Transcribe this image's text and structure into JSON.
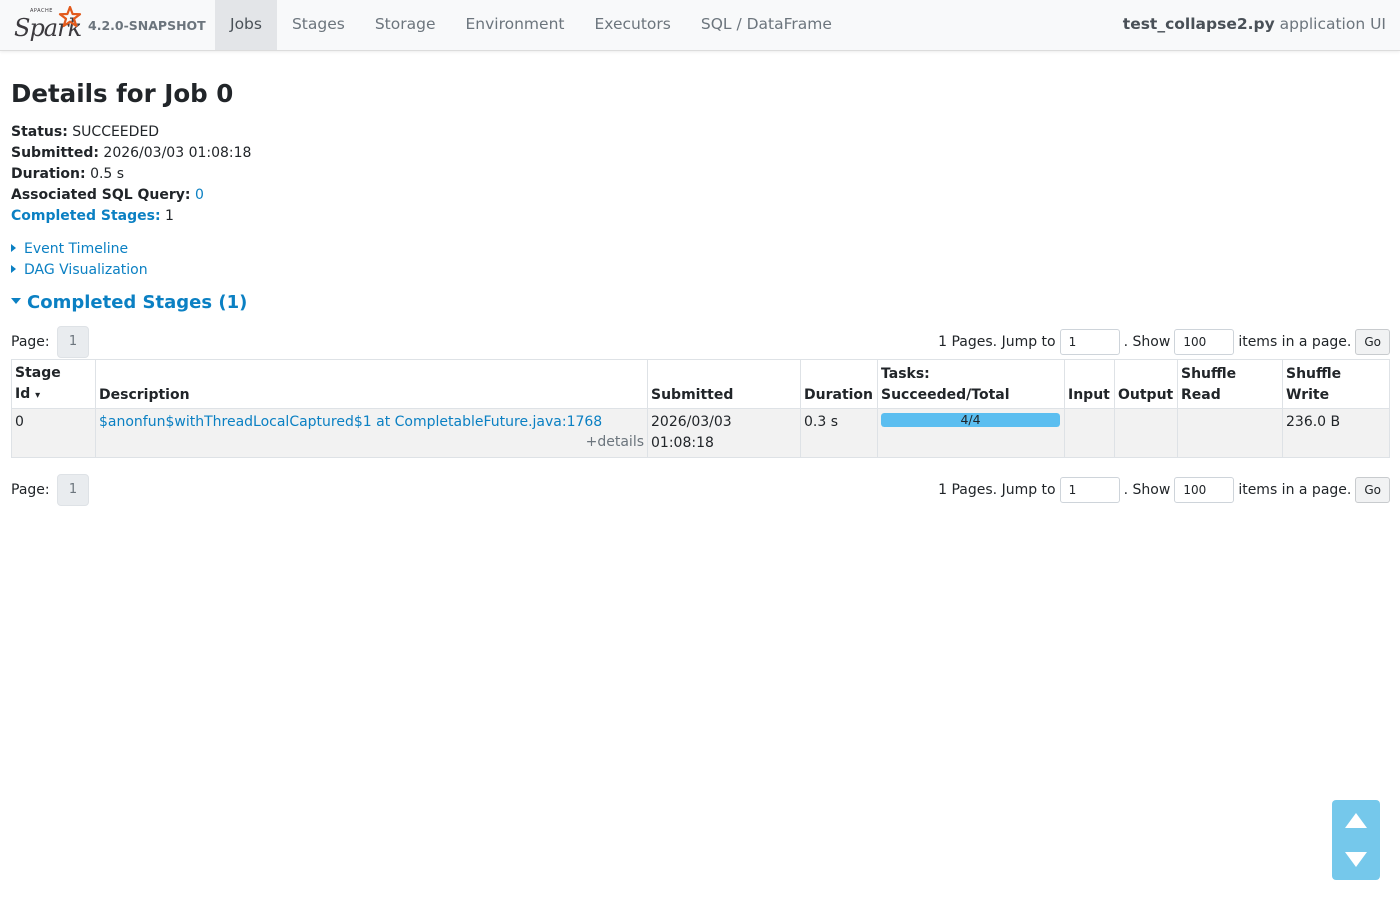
{
  "navbar": {
    "brand_word": "Spark",
    "brand_apache": "APACHE",
    "version": "4.2.0-SNAPSHOT",
    "tabs": [
      {
        "label": "Jobs"
      },
      {
        "label": "Stages"
      },
      {
        "label": "Storage"
      },
      {
        "label": "Environment"
      },
      {
        "label": "Executors"
      },
      {
        "label": "SQL / DataFrame"
      }
    ],
    "active_tab": "Jobs",
    "app_name": "test_collapse2.py",
    "app_suffix": "application UI"
  },
  "page": {
    "title": "Details for Job 0"
  },
  "summary": {
    "status_label": "Status:",
    "status_value": "SUCCEEDED",
    "submitted_label": "Submitted:",
    "submitted_value": "2026/03/03 01:08:18",
    "duration_label": "Duration:",
    "duration_value": "0.5 s",
    "sql_label": "Associated SQL Query:",
    "sql_value": "0",
    "stages_label": "Completed Stages:",
    "stages_value": "1"
  },
  "expanders": {
    "event_timeline": "Event Timeline",
    "dag_visualization": "DAG Visualization"
  },
  "section": {
    "title": "Completed Stages (1)"
  },
  "pagination": {
    "page_label": "Page:",
    "current_page": "1",
    "pages_text": "1 Pages. Jump to",
    "jump_value": "1",
    "show_text": ". Show",
    "page_size_value": "100",
    "items_text": "items in a page.",
    "go_label": "Go"
  },
  "table": {
    "headers": {
      "stage_id_1": "Stage",
      "stage_id_2": "Id",
      "sort_arrow": "▾",
      "description": "Description",
      "submitted": "Submitted",
      "duration": "Duration",
      "tasks_1": "Tasks:",
      "tasks_2": "Succeeded/Total",
      "input": "Input",
      "output": "Output",
      "shuffle_read_1": "Shuffle",
      "shuffle_read_2": "Read",
      "shuffle_write_1": "Shuffle",
      "shuffle_write_2": "Write"
    },
    "rows": [
      {
        "stage_id": "0",
        "description": "$anonfun$withThreadLocalCaptured$1 at CompletableFuture.java:1768",
        "details_toggle": "+details",
        "submitted_date": "2026/03/03",
        "submitted_time": "01:08:18",
        "duration": "0.3 s",
        "tasks_text": "4/4",
        "tasks_succeeded": 4,
        "tasks_total": 4,
        "input": "",
        "output": "",
        "shuffle_read": "",
        "shuffle_write": "236.0 B"
      }
    ]
  },
  "colors": {
    "link": "#0b80c3",
    "progress": "#5bbef0",
    "scroll_widget": "#6ec6ea",
    "spark_star": "#e25a1c"
  },
  "icons": {
    "brand": "spark-star-logo",
    "scroll_up": "triangle-up-icon",
    "scroll_down": "triangle-down-icon",
    "expander": "caret-right-icon",
    "section": "caret-down-icon"
  }
}
